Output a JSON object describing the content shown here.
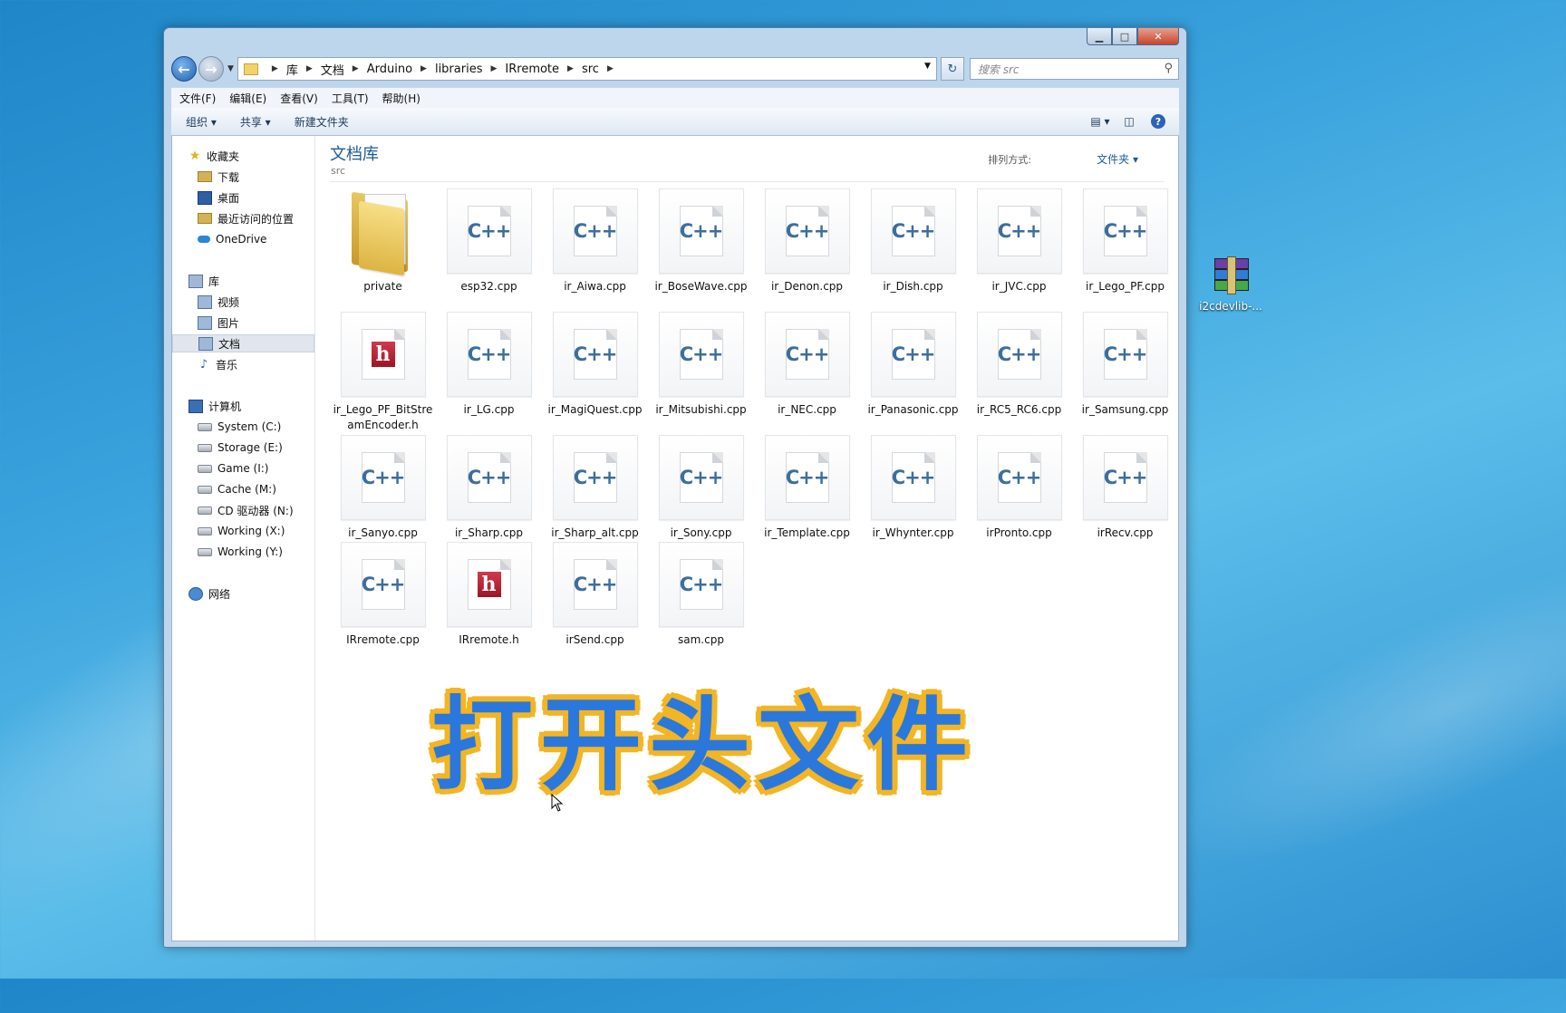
{
  "desktop": {
    "icon_label": "i2cdevlib-..."
  },
  "window": {
    "caption_buttons": {
      "minimize": "▁",
      "maximize": "□",
      "close": "✕"
    },
    "breadcrumb": [
      "库",
      "文档",
      "Arduino",
      "libraries",
      "IRremote",
      "src"
    ],
    "search_placeholder": "搜索 src",
    "menu": [
      "文件(F)",
      "编辑(E)",
      "查看(V)",
      "工具(T)",
      "帮助(H)"
    ],
    "toolbar": {
      "organize": "组织 ▾",
      "share": "共享 ▾",
      "new_folder": "新建文件夹",
      "help": "?"
    },
    "nav": {
      "favorites": {
        "title": "收藏夹",
        "items": [
          "下载",
          "桌面",
          "最近访问的位置",
          "OneDrive"
        ]
      },
      "libraries": {
        "title": "库",
        "items": [
          "视频",
          "图片",
          "文档",
          "音乐"
        ],
        "selected": "文档"
      },
      "computer": {
        "title": "计算机",
        "items": [
          "System (C:)",
          "Storage (E:)",
          "Game (I:)",
          "Cache (M:)",
          "CD 驱动器 (N:)",
          "Working (X:)",
          "Working (Y:)"
        ]
      },
      "network": {
        "title": "网络"
      }
    },
    "content": {
      "library_title": "文档库",
      "library_sub": "src",
      "sort_label": "排列方式:",
      "sort_value": "文件夹 ▾",
      "files": [
        {
          "name": "private",
          "type": "folder"
        },
        {
          "name": "esp32.cpp",
          "type": "cpp"
        },
        {
          "name": "ir_Aiwa.cpp",
          "type": "cpp"
        },
        {
          "name": "ir_BoseWave.cpp",
          "type": "cpp"
        },
        {
          "name": "ir_Denon.cpp",
          "type": "cpp"
        },
        {
          "name": "ir_Dish.cpp",
          "type": "cpp"
        },
        {
          "name": "ir_JVC.cpp",
          "type": "cpp"
        },
        {
          "name": "ir_Lego_PF.cpp",
          "type": "cpp"
        },
        {
          "name": "ir_Lego_PF_BitStreamEncoder.h",
          "type": "h"
        },
        {
          "name": "ir_LG.cpp",
          "type": "cpp"
        },
        {
          "name": "ir_MagiQuest.cpp",
          "type": "cpp"
        },
        {
          "name": "ir_Mitsubishi.cpp",
          "type": "cpp"
        },
        {
          "name": "ir_NEC.cpp",
          "type": "cpp"
        },
        {
          "name": "ir_Panasonic.cpp",
          "type": "cpp"
        },
        {
          "name": "ir_RC5_RC6.cpp",
          "type": "cpp"
        },
        {
          "name": "ir_Samsung.cpp",
          "type": "cpp"
        },
        {
          "name": "ir_Sanyo.cpp",
          "type": "cpp"
        },
        {
          "name": "ir_Sharp.cpp",
          "type": "cpp"
        },
        {
          "name": "ir_Sharp_alt.cpp",
          "type": "cpp"
        },
        {
          "name": "ir_Sony.cpp",
          "type": "cpp"
        },
        {
          "name": "ir_Template.cpp",
          "type": "cpp"
        },
        {
          "name": "ir_Whynter.cpp",
          "type": "cpp"
        },
        {
          "name": "irPronto.cpp",
          "type": "cpp"
        },
        {
          "name": "irRecv.cpp",
          "type": "cpp"
        },
        {
          "name": "IRremote.cpp",
          "type": "cpp"
        },
        {
          "name": "IRremote.h",
          "type": "h"
        },
        {
          "name": "irSend.cpp",
          "type": "cpp"
        },
        {
          "name": "sam.cpp",
          "type": "cpp"
        }
      ]
    }
  },
  "overlay_caption": "打开头文件",
  "icon_glyphs": {
    "cpp": "C++",
    "h": "h"
  }
}
